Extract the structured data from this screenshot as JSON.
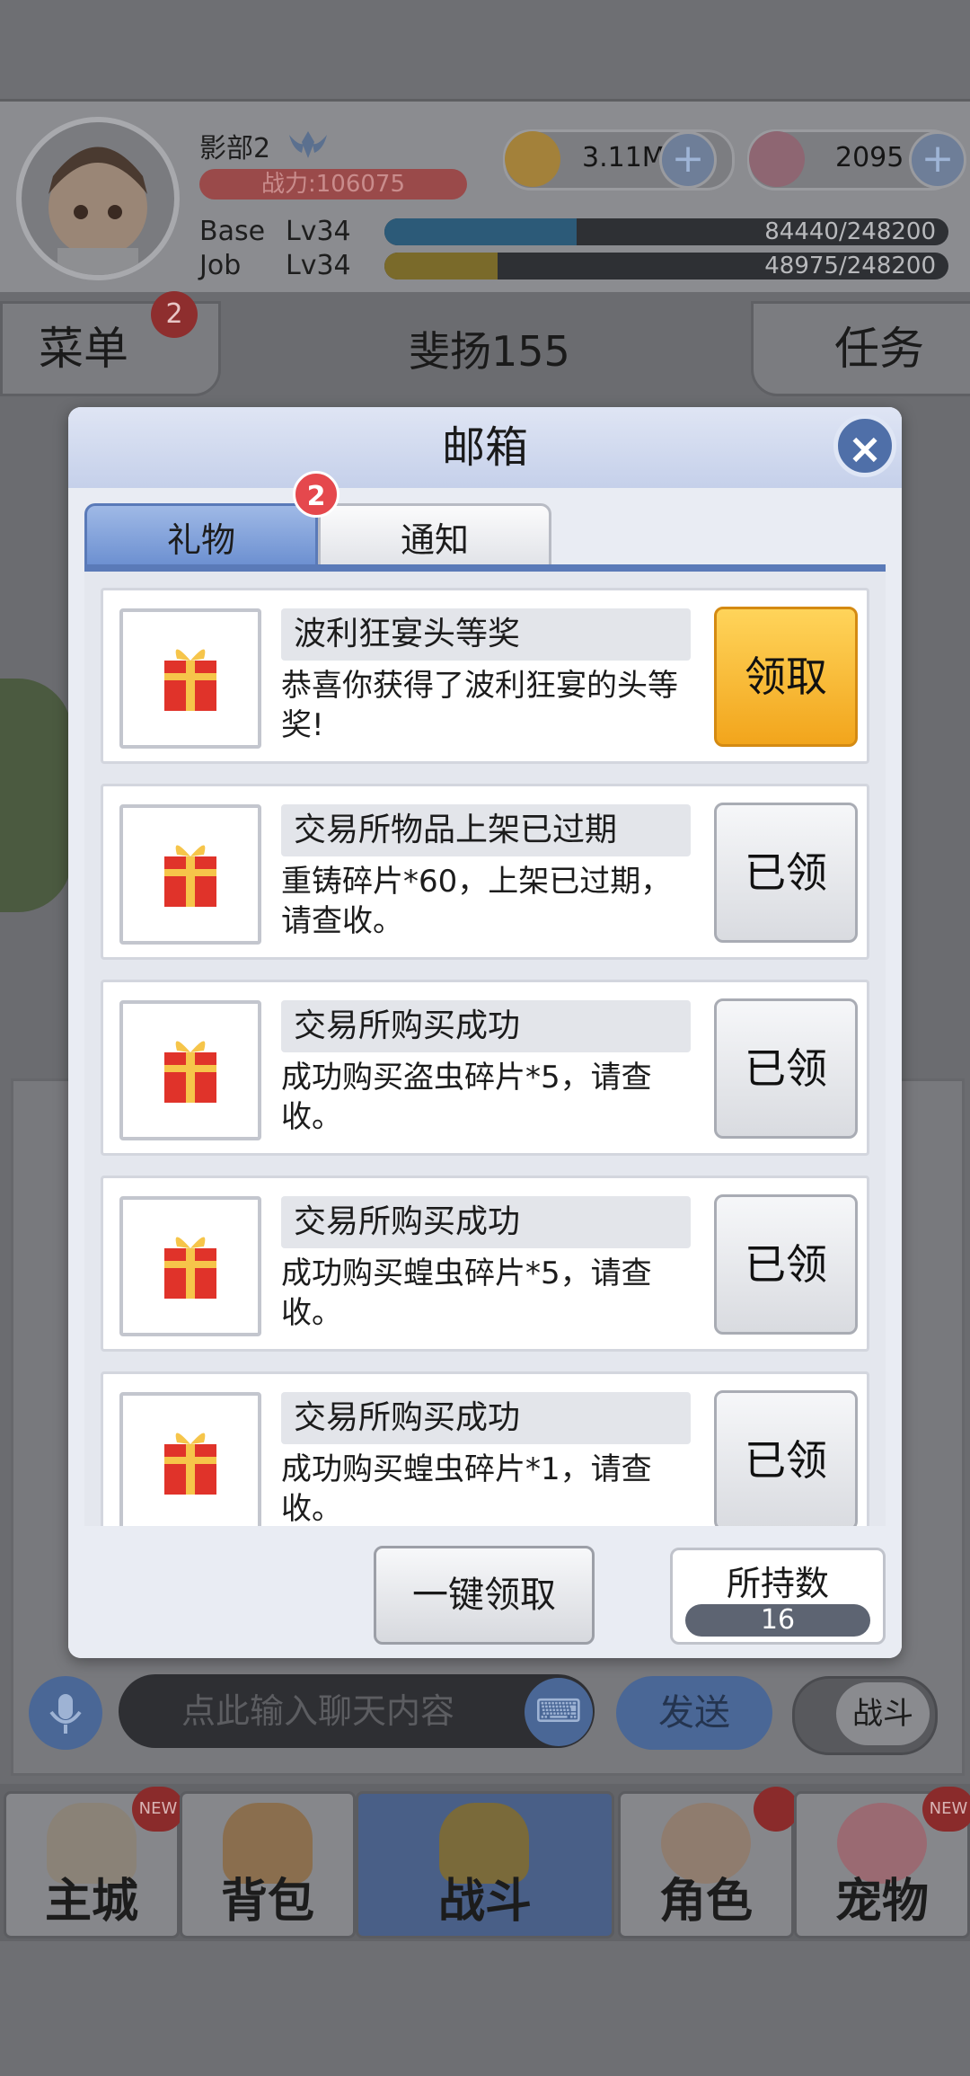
{
  "player": {
    "name": "影部2",
    "power": "战力:106075",
    "zeny": "3.11M",
    "gems": "2095",
    "base_label": "Base",
    "base_level": "Lv34",
    "base_exp": "84440/248200",
    "base_exp_fraction": 0.34,
    "job_label": "Job",
    "job_level": "Lv34",
    "job_exp": "48975/248200",
    "job_exp_fraction": 0.2
  },
  "nav": {
    "menu_label": "菜单",
    "menu_badge": "2",
    "map_name": "斐扬155",
    "task_label": "任务"
  },
  "chat": {
    "input_placeholder": "点此输入聊天内容",
    "send_label": "发送",
    "battle_toggle": "战斗"
  },
  "bottom_nav": {
    "items": [
      {
        "label": "主城",
        "badge": "NEW"
      },
      {
        "label": "背包",
        "badge": ""
      },
      {
        "label": "战斗",
        "badge": ""
      },
      {
        "label": "角色",
        "badge": ""
      },
      {
        "label": "宠物",
        "badge": "NEW"
      }
    ]
  },
  "mailbox": {
    "title": "邮箱",
    "close_icon": "×",
    "tabs": [
      {
        "label": "礼物",
        "active": true
      },
      {
        "label": "通知",
        "active": false
      }
    ],
    "gift_badge": "2",
    "items": [
      {
        "subject": "波利狂宴头等奖",
        "body": "恭喜你获得了波利狂宴的头等奖!",
        "button": "领取",
        "state": "claim"
      },
      {
        "subject": "交易所物品上架已过期",
        "body": "重铸碎片*60，上架已过期，请查收。",
        "button": "已领",
        "state": "claimed"
      },
      {
        "subject": "交易所购买成功",
        "body": "成功购买盗虫碎片*5，请查收。",
        "button": "已领",
        "state": "claimed"
      },
      {
        "subject": "交易所购买成功",
        "body": "成功购买蝗虫碎片*5，请查收。",
        "button": "已领",
        "state": "claimed"
      },
      {
        "subject": "交易所购买成功",
        "body": "成功购买蝗虫碎片*1，请查收。",
        "button": "已领",
        "state": "claimed"
      }
    ],
    "claim_all_label": "一键领取",
    "held_label": "所持数",
    "held_count": "16"
  },
  "colors": {
    "accent_blue": "#5a7ab8",
    "claim_gold": "#f2a51c",
    "badge_red": "#e5484d"
  }
}
